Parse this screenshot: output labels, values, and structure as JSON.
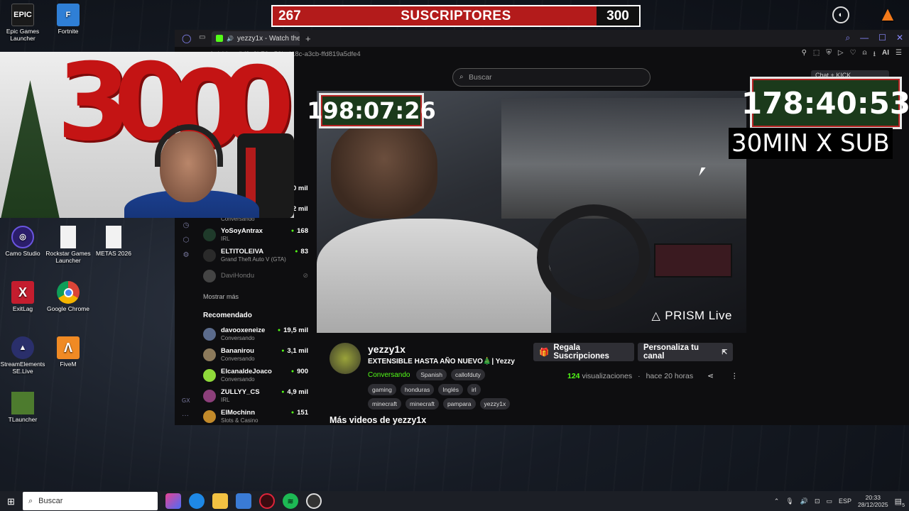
{
  "subscriber_goal": {
    "current": "267",
    "label": "SUSCRIPTORES",
    "goal": "300",
    "progress": 0.89
  },
  "desktop_icons": [
    {
      "label": "Epic Games Launcher",
      "glyph": "EPIC",
      "color": "#1a1a1a"
    },
    {
      "label": "Fortnite",
      "glyph": "F",
      "color": "#2f7fd6"
    },
    {
      "label": "Camo Studio",
      "glyph": "◎",
      "color": "#2b1e6b"
    },
    {
      "label": "Rockstar Games Launcher",
      "glyph": "",
      "color": "#f2f2f2"
    },
    {
      "label": "METAS 2026",
      "glyph": "",
      "color": "#f2f2f2"
    },
    {
      "label": "ExitLag",
      "glyph": "X",
      "color": "#c41d2e"
    },
    {
      "label": "Google Chrome",
      "glyph": "",
      "color": "#e9e9e9"
    },
    {
      "label": "StreamElements SE.Live",
      "glyph": "▲",
      "color": "#2a2f6b"
    },
    {
      "label": "FiveM",
      "glyph": "Λ",
      "color": "#f08a24"
    },
    {
      "label": "TLauncher",
      "glyph": "",
      "color": "#4d7b2e"
    },
    {
      "label": "VLC",
      "glyph": "▲",
      "color": "#f47a1a"
    }
  ],
  "browser": {
    "tab_title": "yezzy1x - Watch the V...",
    "url": "cy1x/videos/bf9e9b76-c59b-418c-a3cb-ffd819a5dfe4",
    "search_placeholder": "Buscar",
    "toolbar_ai": "AI"
  },
  "sidebar": {
    "following": [
      {
        "name": "YoSoyAntrax",
        "category": "IRL",
        "viewers": "168",
        "live": true
      },
      {
        "name": "ELTITOLEIVA",
        "category": "Grand Theft Auto V (GTA)",
        "viewers": "83",
        "live": true
      },
      {
        "name": "DaviHondu",
        "category": "",
        "viewers": "",
        "live": false
      }
    ],
    "partial_viewers": [
      "0 mil",
      "2 mil"
    ],
    "partial_category": "Conversando",
    "show_more": "Mostrar más",
    "recommended_title": "Recomendado",
    "recommended": [
      {
        "name": "davooxeneize",
        "category": "Conversando",
        "viewers": "19,5 mil",
        "color": "#5b6b8c"
      },
      {
        "name": "Bananirou",
        "category": "Conversando",
        "viewers": "3,1 mil",
        "color": "#8c7a5b"
      },
      {
        "name": "ElcanaldeJoaco",
        "category": "Conversando",
        "viewers": "900",
        "color": "#8fd93a"
      },
      {
        "name": "ZULLYY_CS",
        "category": "IRL",
        "viewers": "4,9 mil",
        "color": "#8c3f7a"
      },
      {
        "name": "ElMochinn",
        "category": "Slots & Casino",
        "viewers": "151",
        "color": "#c28a2a"
      }
    ]
  },
  "video": {
    "overlay_text": "PRISM Live",
    "timer_left": "198:07:26"
  },
  "overlay": {
    "timer_right": "178:40:53",
    "sub_rule": "30MIN X SUB",
    "kick_badge": "Chat + KICK"
  },
  "channel": {
    "name": "yezzy1x",
    "title": "EXTENSIBLE HASTA AÑO NUEVO🎄| Yezzy",
    "category": "Conversando",
    "tags_row1": [
      "Spanish",
      "callofduty"
    ],
    "tags_row2": [
      "gaming",
      "honduras",
      "Inglés",
      "irl"
    ],
    "tags_row3": [
      "minecraft",
      "minecraft",
      "pampara",
      "yezzy1x"
    ],
    "gift_button": "Regala Suscripciones",
    "customize_button": "Personaliza tu canal",
    "views": "124",
    "views_label": "visualizaciones",
    "time_ago": "hace 20 horas",
    "more_videos": "Más videos de yezzy1x"
  },
  "taskbar": {
    "search_placeholder": "Buscar",
    "language": "ESP",
    "time": "20:33",
    "date": "28/12/2025",
    "notif_count": "5"
  }
}
